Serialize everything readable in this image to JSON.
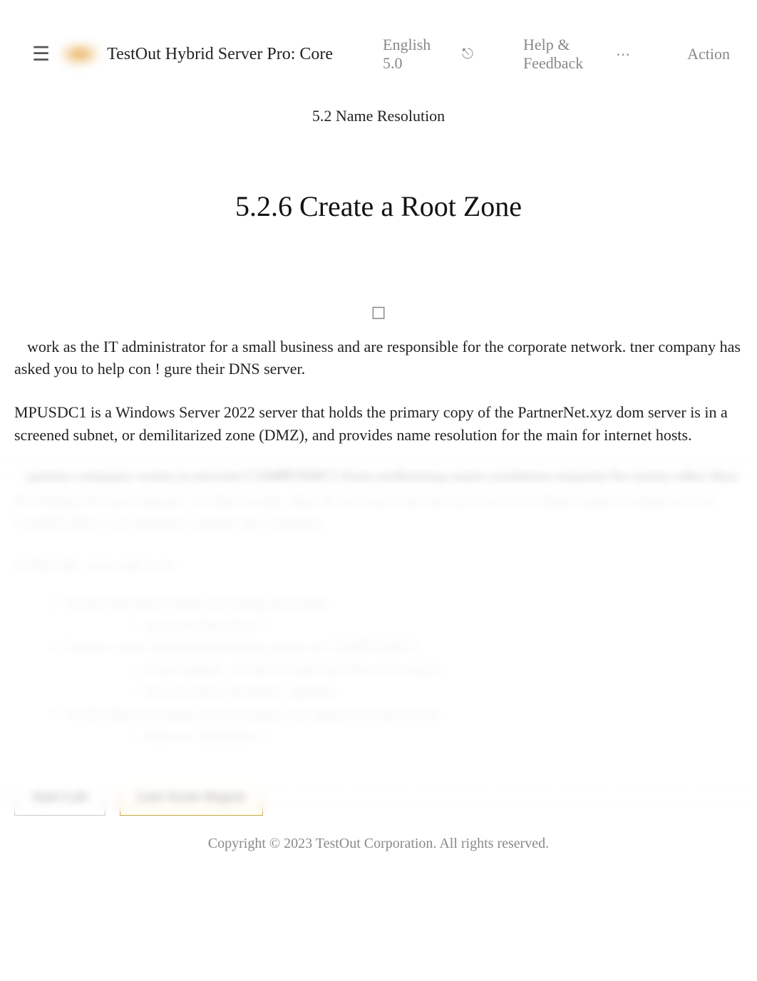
{
  "topbar": {
    "hamburger_glyph": "☰",
    "product": "TestOut Hybrid Server Pro: Core",
    "lang_glyph": "⎋",
    "language": "English 5.0",
    "help": "Help & Feedback",
    "action_glyph": "⋯",
    "actions": "Action"
  },
  "breadcrumb": "5.2 Name Resolution",
  "title": "5.2.6 Create a Root Zone",
  "center_icon_glyph": "◻",
  "paragraphs": {
    "p1": "work as the IT administrator for a small business and are responsible for the corporate network. tner company has asked you to help con          ! gure their DNS server.",
    "p2": "MPUSDC1 is a Windows Server 2022 server that holds the primary copy of the PartnerNet.xyz dom server is in a screened subnet, or demilitarized zone (DMZ), and provides name resolution for the main for internet hosts.",
    "p3": "partner company wants to prevent CAMPUSDC1 from performing name resolution requests for mains other than the PartnerNet.xyz domain. In other words, they do not want internet hosts to be to obtain name resolution from CAMPUSDC1 for domains outside the company."
  },
  "tasks_lead": "In this lab, your task is to:",
  "tasks": [
    {
      "text": "Verify that Root Hints are being provided.",
      "sub": [
        "Answer Question 1."
      ]
    },
    {
      "text": "Create a new forwarding lookup zone on CAMPUSDC1.",
      "sub": [
        "Zone named    . (a dot to represent the root zone).",
        "Do not allow dynamic updates."
      ]
    },
    {
      "text": "Verify that root hints are no longer con        !gured on the server.",
      "sub": [
        "Answer Question 2."
      ]
    }
  ],
  "buttons": {
    "start": "Start Lab",
    "report": "Last Score Report"
  },
  "copyright": "Copyright © 2023 TestOut Corporation.        All rights reserved."
}
